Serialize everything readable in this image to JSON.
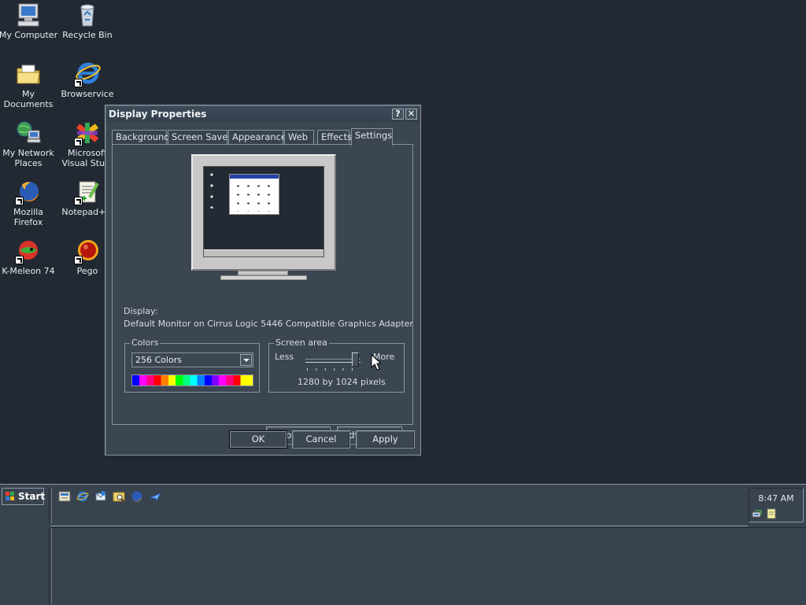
{
  "desktop": {
    "icons": [
      {
        "label": "My Computer",
        "icon": "computer-icon"
      },
      {
        "label": "Recycle Bin",
        "icon": "recycle-bin-icon"
      },
      {
        "label": "My Documents",
        "icon": "folder-icon"
      },
      {
        "label": "Browservice",
        "icon": "internet-explorer-icon"
      },
      {
        "label": "My Network Places",
        "icon": "network-icon"
      },
      {
        "label": "Microsoft Visual Stu...",
        "icon": "visual-studio-icon"
      },
      {
        "label": "Mozilla Firefox",
        "icon": "firefox-icon"
      },
      {
        "label": "Notepad++",
        "icon": "notepad-plus-plus-icon"
      },
      {
        "label": "K-Meleon 74",
        "icon": "k-meleon-icon"
      },
      {
        "label": "Pego",
        "icon": "pego-icon"
      }
    ]
  },
  "dialog": {
    "title": "Display Properties",
    "help_label": "?",
    "close_label": "✕",
    "tabs": [
      {
        "label": "Background"
      },
      {
        "label": "Screen Saver"
      },
      {
        "label": "Appearance"
      },
      {
        "label": "Web"
      },
      {
        "label": "Effects"
      },
      {
        "label": "Settings",
        "active": true
      }
    ],
    "display_label": "Display:",
    "display_value": "Default Monitor on Cirrus Logic 5446 Compatible Graphics Adapter",
    "colors": {
      "legend": "Colors",
      "selected": "256 Colors"
    },
    "screen_area": {
      "legend": "Screen area",
      "less": "Less",
      "more": "More",
      "value_label": "1280 by 1024 pixels",
      "slider_level": 0.9
    },
    "buttons": {
      "troubleshoot": "Troubleshoot...",
      "advanced": "Advanced...",
      "ok": "OK",
      "cancel": "Cancel",
      "apply": "Apply"
    }
  },
  "taskbar": {
    "start_label": "Start",
    "quick_launch": [
      "show-desktop-icon",
      "internet-explorer-icon",
      "outlook-express-icon",
      "explorer-icon",
      "firefox-icon",
      "plane-icon"
    ],
    "clock": "8:47 AM",
    "tray_icons": [
      "network-tray-icon",
      "notepad-tray-icon"
    ]
  },
  "colors": {
    "desktop_bg": "#222933",
    "dialog_bg": "#3b4652",
    "taskbar_bg": "#38434e"
  }
}
